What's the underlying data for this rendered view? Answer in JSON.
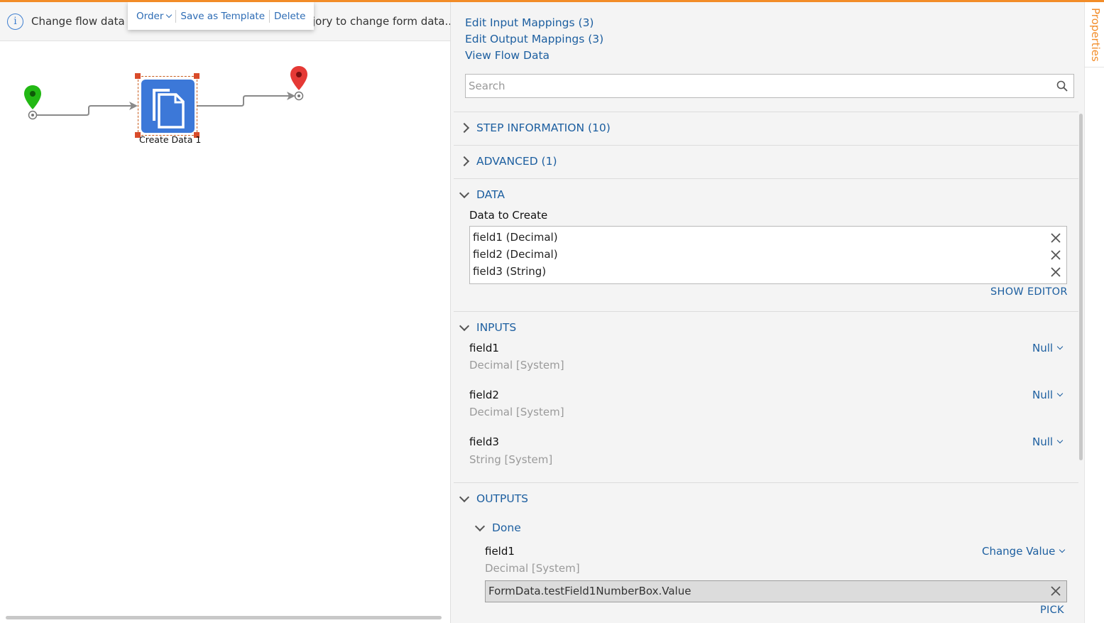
{
  "canvas": {
    "info_text": "Change flow data c",
    "info_text_tail": "jory to change form data...",
    "context_menu": {
      "order": "Order",
      "save_as_template": "Save as Template",
      "delete": "Delete"
    },
    "step": {
      "label": "Create Data 1"
    }
  },
  "panel": {
    "links": {
      "edit_input_mappings": "Edit Input Mappings (3)",
      "edit_output_mappings": "Edit Output Mappings (3)",
      "view_flow_data": "View Flow Data"
    },
    "search": {
      "placeholder": "Search",
      "value": ""
    },
    "sections": {
      "step_information": "STEP INFORMATION (10)",
      "advanced": "ADVANCED (1)",
      "data": "DATA",
      "inputs": "INPUTS",
      "outputs": "OUTPUTS"
    },
    "data": {
      "label": "Data to Create",
      "items": [
        "field1 (Decimal)",
        "field2 (Decimal)",
        "field3 (String)"
      ],
      "show_editor": "SHOW EDITOR"
    },
    "inputs": [
      {
        "name": "field1",
        "type": "Decimal [System]",
        "action": "Null"
      },
      {
        "name": "field2",
        "type": "Decimal [System]",
        "action": "Null"
      },
      {
        "name": "field3",
        "type": "String [System]",
        "action": "Null"
      }
    ],
    "outputs": {
      "path": "Done",
      "field": {
        "name": "field1",
        "type": "Decimal [System]",
        "action": "Change Value",
        "value": "FormData.testField1NumberBox.Value",
        "pick": "PICK"
      }
    }
  },
  "side_tab": {
    "label": "Properties"
  },
  "colors": {
    "accent": "#f28c28",
    "link": "#1d5fa0",
    "step_icon": "#3c78d8",
    "start": "#22b814",
    "end": "#e53935"
  }
}
